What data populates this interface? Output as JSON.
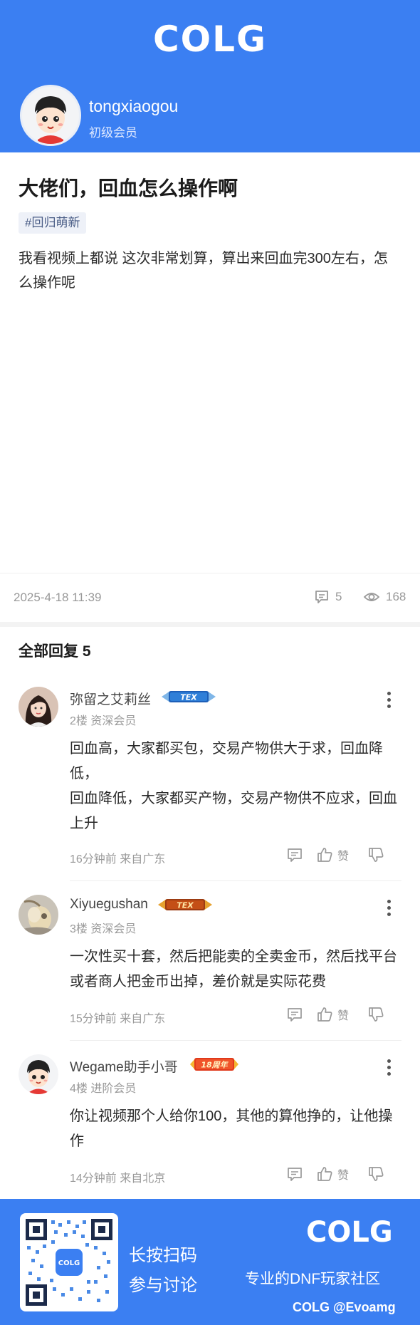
{
  "brand": {
    "logo": "COLG",
    "watermark": "COLG @Evoamg"
  },
  "author": {
    "username": "tongxiaogou",
    "level": "初级会员"
  },
  "post": {
    "title": "大佬们，回血怎么操作啊",
    "tag": "#回归萌新",
    "body": "我看视频上都说 这次非常划算，算出来回血完300左右，怎么操作呢",
    "date": "2025-4-18 11:39",
    "comment_count": "5",
    "view_count": "168"
  },
  "replies": {
    "heading": "全部回复  5",
    "items": [
      {
        "name": "弥留之艾莉丝",
        "badge": "TEX",
        "floor": "2楼  资深会员",
        "lines": [
          "回血高，大家都买包，交易产物供大于求，回血降低，",
          "回血降低，大家都买产物，交易产物供不应求，回血上升"
        ],
        "time": "16分钟前  来自广东",
        "like_label": "赞"
      },
      {
        "name": "Xiyuegushan",
        "badge": "TEX",
        "floor": "3楼  资深会员",
        "lines": [
          "一次性买十套，然后把能卖的全卖金币，然后找平台或者商人把金币出掉，差价就是实际花费"
        ],
        "time": "15分钟前  来自广东",
        "like_label": "赞"
      },
      {
        "name": "Wegame助手小哥",
        "badge": "18周年",
        "floor": "4楼  进阶会员",
        "lines": [
          "你让视频那个人给你100，其他的算他挣的，让他操作"
        ],
        "time": "14分钟前  来自北京",
        "like_label": "赞"
      }
    ]
  },
  "footer": {
    "line1": "长按扫码",
    "line2": "参与讨论",
    "logo": "COLG",
    "slogan": "专业的DNF玩家社区"
  },
  "colors": {
    "brand_blue": "#3b7ff2",
    "muted": "#999999",
    "tag_bg": "#eef1f8"
  }
}
